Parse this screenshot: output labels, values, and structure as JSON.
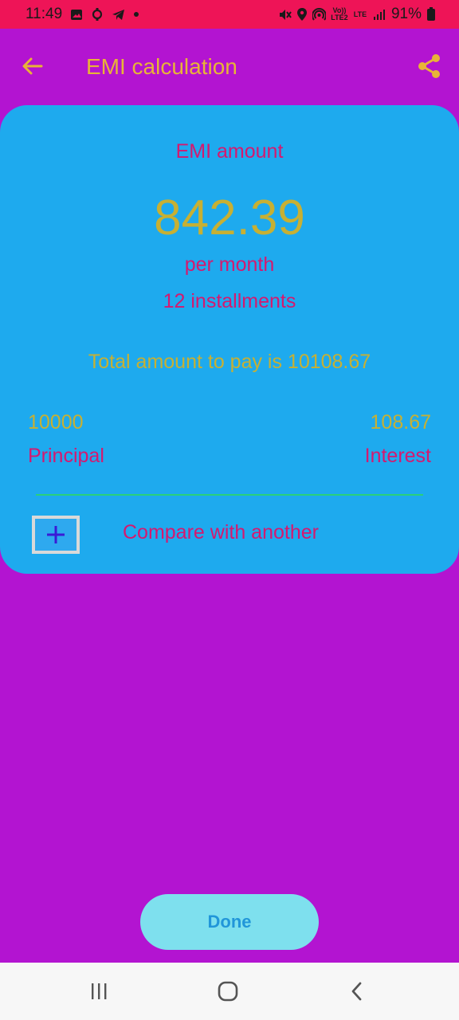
{
  "status_bar": {
    "time": "11:49",
    "battery_percent": "91%",
    "volte_label": "Vo)) LTE2",
    "lte_label": "LTE",
    "left_icons": [
      "image-icon",
      "sync-icon",
      "telegram-icon",
      "dot-icon"
    ],
    "right_icons": [
      "mute-icon",
      "location-icon",
      "hotspot-icon",
      "volte-icon",
      "lte-icon",
      "signal-icon",
      "battery-icon"
    ]
  },
  "app_bar": {
    "title": "EMI calculation",
    "back_icon": "arrow-left-icon",
    "share_icon": "share-icon"
  },
  "result_card": {
    "emi_label": "EMI amount",
    "emi_value": "842.39",
    "per_month": "per month",
    "installments": "12 installments",
    "total_text": "Total amount to pay is 10108.67",
    "principal_value": "10000",
    "principal_label": "Principal",
    "interest_value": "108.67",
    "interest_label": "Interest",
    "compare_label": "Compare with another",
    "compare_icon": "plus-icon"
  },
  "done_button": {
    "label": "Done"
  },
  "nav_bar": {
    "icons": [
      "recents-icon",
      "home-icon",
      "back-icon"
    ]
  },
  "colors": {
    "background": "#b314d1",
    "status_bar": "#ee1457",
    "card": "#1eaaee",
    "accent_gold": "#c7b033",
    "accent_pink": "#d5196f",
    "title_gold": "#e8b437",
    "divider": "#2ad07a",
    "done_bg": "#7ee0ee",
    "done_text": "#2196d9"
  }
}
